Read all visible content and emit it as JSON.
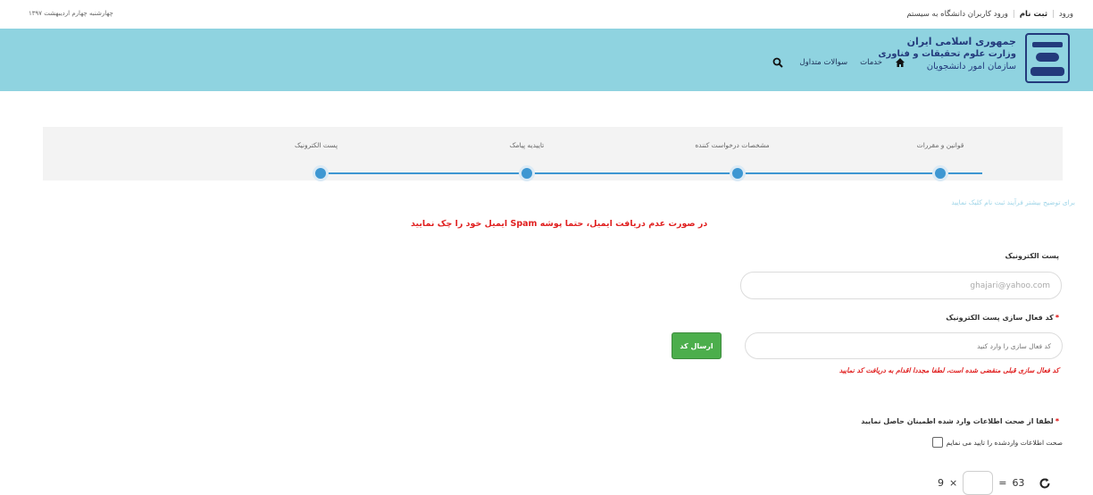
{
  "topbar": {
    "date": "چهارشنبه چهارم اردیبهشت ۱۳۹۷",
    "login": "ورود",
    "signup": "ثبت نام",
    "university_login": "ورود کاربران دانشگاه به سیستم"
  },
  "header": {
    "org_line1": "جمهوری اسلامی ایران",
    "org_line2": "وزارت علوم تحقیقات و فناوری",
    "org_line3": "سازمان امور دانشجویان",
    "nav_services": "خدمات",
    "nav_faq": "سوالات متداول"
  },
  "stepper": {
    "steps": [
      {
        "label": "قوانین و مقررات"
      },
      {
        "label": "مشخصات درخواست کننده"
      },
      {
        "label": "تاییدیه پیامک"
      },
      {
        "label": "پست الکترونیک"
      }
    ]
  },
  "help_link": "برای توضیح بیشتر فرآیند ثبت نام کلیک نمایید",
  "spam_note": "در صورت عدم دریافت ایمیل، حتما پوشه Spam ایمیل خود را چک نمایید",
  "form": {
    "email_label": "پست الکترونیک",
    "email_value": "ghajari@yahoo.com",
    "code_label": "کد فعال سازی پست الکترونیک",
    "code_placeholder": "کد فعال سازی را وارد کنید",
    "send_button": "ارسال کد",
    "expire_note": "کد فعال سازی قبلی منقضی شده است، لطفا مجددا اقدام به دریافت کد نمایید",
    "confirm_label": "لطفا از صحت اطلاعات وارد شده اطمینان حاصل نمایید",
    "confirm_checkbox_text": "صحت اطلاعات واردشده را تایید می نمایم",
    "required_mark": "*"
  },
  "captcha": {
    "operand": "9",
    "operator": "×",
    "equals": "=",
    "result": "63"
  },
  "colors": {
    "header_bg": "#8fd3e0",
    "step_accent": "#3e97d2",
    "send_button": "#4cae4c",
    "error_text": "#e02020"
  }
}
